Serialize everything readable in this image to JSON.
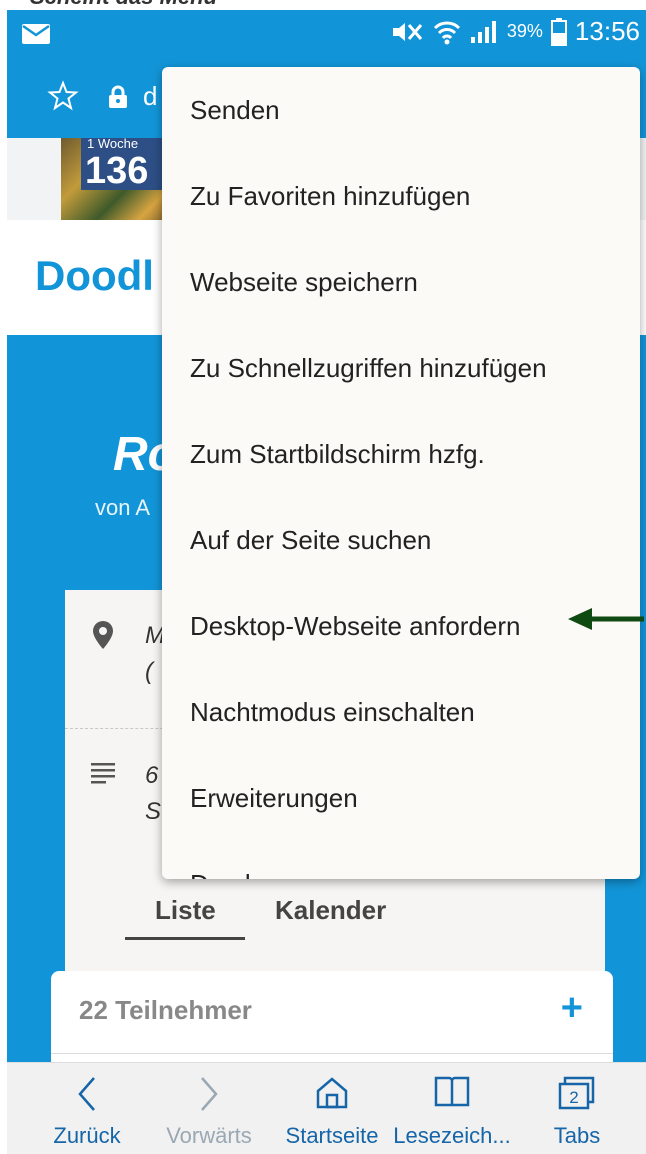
{
  "caption": "Scheint das Menü",
  "status_bar": {
    "battery": "39%",
    "time": "13:56"
  },
  "toolbar": {
    "url_prefix": "d"
  },
  "banner": {
    "small_text": "1 Woche",
    "big_text": "136"
  },
  "page": {
    "logo": "Doodl",
    "poll_title": "Ro",
    "poll_author": "von A",
    "location_line1": "M",
    "location_line2": "(",
    "description_line1": "6",
    "description_line2": "S",
    "tabs": [
      "Liste",
      "Kalender"
    ],
    "participants_label": "22 Teilnehmer",
    "add_symbol": "+"
  },
  "menu": {
    "items": [
      "Senden",
      "Zu Favoriten hinzufügen",
      "Webseite speichern",
      "Zu Schnellzugriffen hinzufügen",
      "Zum Startbildschirm hzfg.",
      "Auf der Seite suchen",
      "Desktop-Webseite anfordern",
      "Nachtmodus einschalten",
      "Erweiterungen",
      "Drucken"
    ],
    "highlighted_item": "Desktop-Webseite anfordern",
    "arrow_color": "#0e4a12"
  },
  "bottom_nav": [
    {
      "label": "Zurück",
      "icon": "back-chevron-icon",
      "enabled": true
    },
    {
      "label": "Vorwärts",
      "icon": "forward-chevron-icon",
      "enabled": false
    },
    {
      "label": "Startseite",
      "icon": "home-icon",
      "enabled": true
    },
    {
      "label": "Lesezeich...",
      "icon": "bookmarks-icon",
      "enabled": true
    },
    {
      "label": "Tabs",
      "icon": "tabs-icon",
      "enabled": true,
      "count": "2"
    }
  ],
  "colors": {
    "accent": "#1295d8",
    "nav_text": "#1565a8"
  }
}
